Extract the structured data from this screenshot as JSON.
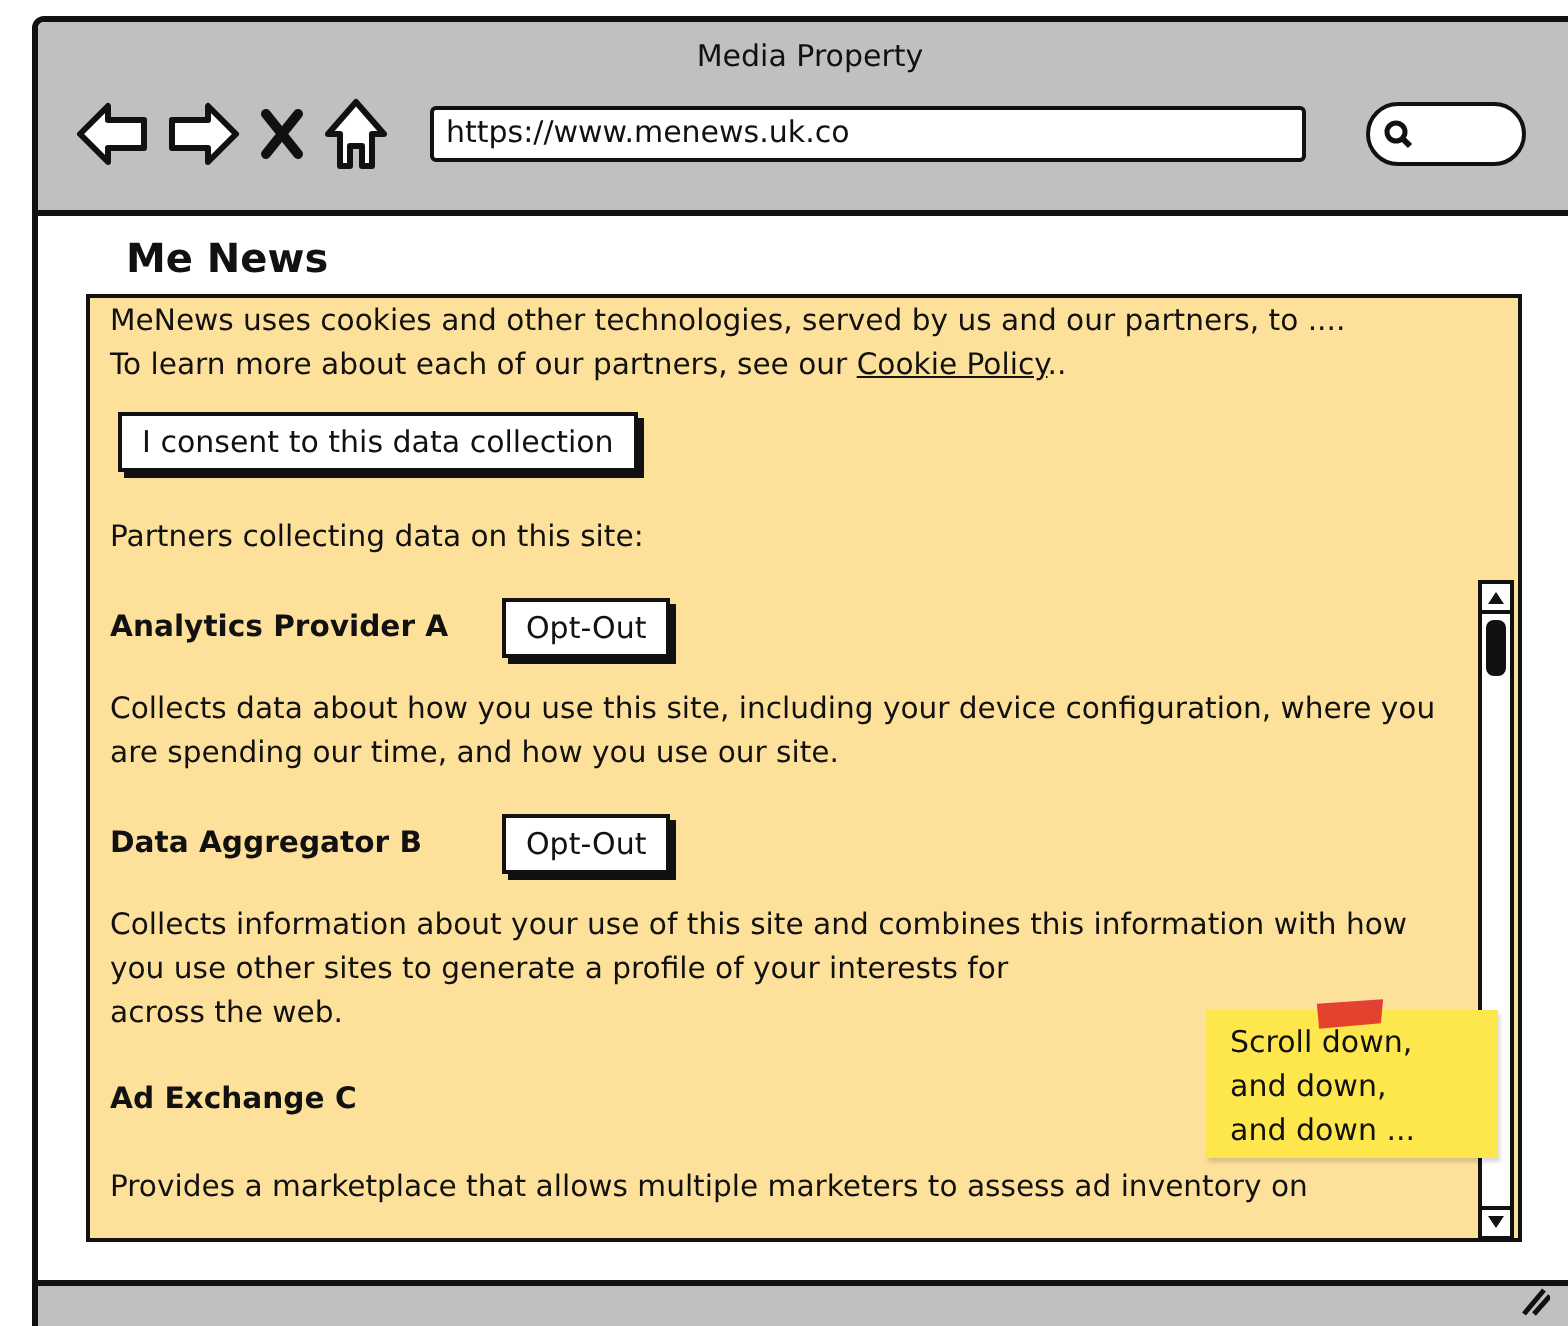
{
  "window": {
    "title": "Media Property"
  },
  "toolbar": {
    "url": "https://www.menews.uk.co"
  },
  "page": {
    "heading": "Me News"
  },
  "consent_panel": {
    "intro": "MeNews uses cookies and other technologies, served by us and our partners, to ....",
    "learn_more": "To learn more about each of our partners, see our",
    "policy_link": "Cookie Policy",
    "link_suffix": "..",
    "consent_button": "I consent to this data collection",
    "partners_heading": "Partners collecting data on this site:",
    "partners": [
      {
        "name": "Analytics Provider A",
        "button": "Opt-Out",
        "description": "Collects data about how you use this site, including your device configuration, where you are spending our time, and how you use our site."
      },
      {
        "name": "Data Aggregator B",
        "button": "Opt-Out",
        "description": "Collects information about your use of this site and combines this information with how you use other sites to generate a profile of your interests for",
        "description_end": "across the web."
      },
      {
        "name": "Ad Exchange C",
        "description": "Provides a marketplace that allows multiple marketers to assess ad inventory on"
      }
    ]
  },
  "sticky_note": {
    "lines": [
      "Scroll down,",
      "and down,",
      "and down ..."
    ]
  }
}
